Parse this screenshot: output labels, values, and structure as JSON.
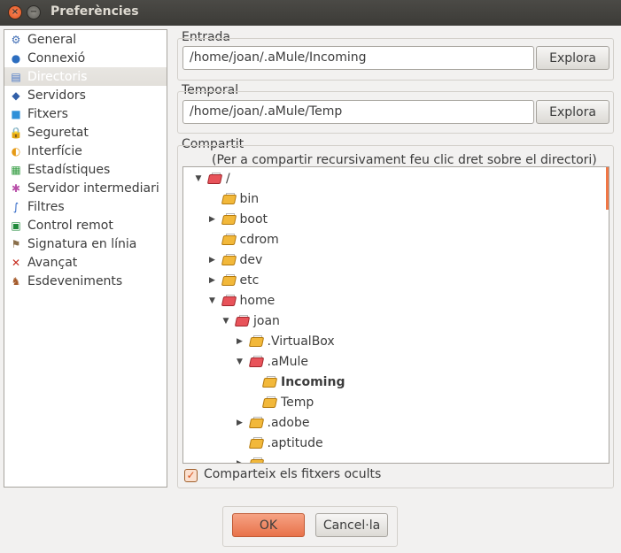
{
  "window": {
    "title": "Preferències",
    "close_glyph": "×",
    "minimize_glyph": "−"
  },
  "sidebar": {
    "items": [
      {
        "label": "General",
        "icon": "general-icon",
        "selected": false
      },
      {
        "label": "Connexió",
        "icon": "connection-icon",
        "selected": false
      },
      {
        "label": "Directoris",
        "icon": "directories-icon",
        "selected": true
      },
      {
        "label": "Servidors",
        "icon": "servers-icon",
        "selected": false
      },
      {
        "label": "Fitxers",
        "icon": "files-icon",
        "selected": false
      },
      {
        "label": "Seguretat",
        "icon": "lock-icon",
        "selected": false
      },
      {
        "label": "Interfície",
        "icon": "interface-icon",
        "selected": false
      },
      {
        "label": "Estadístiques",
        "icon": "statistics-icon",
        "selected": false
      },
      {
        "label": "Servidor intermediari",
        "icon": "proxy-icon",
        "selected": false
      },
      {
        "label": "Filtres",
        "icon": "filter-icon",
        "selected": false
      },
      {
        "label": "Control remot",
        "icon": "remote-control-icon",
        "selected": false
      },
      {
        "label": "Signatura en línia",
        "icon": "signature-icon",
        "selected": false
      },
      {
        "label": "Avançat",
        "icon": "advanced-icon",
        "selected": false
      },
      {
        "label": "Esdeveniments",
        "icon": "events-icon",
        "selected": false
      }
    ]
  },
  "incoming": {
    "label": "Entrada",
    "value": "/home/joan/.aMule/Incoming",
    "browse_label": "Explora"
  },
  "temp": {
    "label": "Temporal",
    "value": "/home/joan/.aMule/Temp",
    "browse_label": "Explora"
  },
  "shared": {
    "label": "Compartit",
    "hint": "(Per a compartir recursivament feu clic dret sobre el directori)",
    "tree": [
      {
        "label": "/",
        "depth": 0,
        "expander": "expanded",
        "color": "red",
        "bold": false
      },
      {
        "label": "bin",
        "depth": 1,
        "expander": "none",
        "color": "yellow",
        "bold": false
      },
      {
        "label": "boot",
        "depth": 1,
        "expander": "collapsed",
        "color": "yellow",
        "bold": false
      },
      {
        "label": "cdrom",
        "depth": 1,
        "expander": "none",
        "color": "yellow",
        "bold": false
      },
      {
        "label": "dev",
        "depth": 1,
        "expander": "collapsed",
        "color": "yellow",
        "bold": false
      },
      {
        "label": "etc",
        "depth": 1,
        "expander": "collapsed",
        "color": "yellow",
        "bold": false
      },
      {
        "label": "home",
        "depth": 1,
        "expander": "expanded",
        "color": "red",
        "bold": false
      },
      {
        "label": "joan",
        "depth": 2,
        "expander": "expanded",
        "color": "red",
        "bold": false
      },
      {
        "label": ".VirtualBox",
        "depth": 3,
        "expander": "collapsed",
        "color": "yellow",
        "bold": false
      },
      {
        "label": ".aMule",
        "depth": 3,
        "expander": "expanded",
        "color": "red",
        "bold": false
      },
      {
        "label": "Incoming",
        "depth": 4,
        "expander": "none",
        "color": "yellow",
        "bold": true
      },
      {
        "label": "Temp",
        "depth": 4,
        "expander": "none",
        "color": "yellow",
        "bold": false
      },
      {
        "label": ".adobe",
        "depth": 3,
        "expander": "collapsed",
        "color": "yellow",
        "bold": false
      },
      {
        "label": ".aptitude",
        "depth": 3,
        "expander": "none",
        "color": "yellow",
        "bold": false
      }
    ],
    "hidden_checkbox_label": "Comparteix els fitxers ocults",
    "hidden_checked": true,
    "check_glyph": "✓",
    "accent_color": "#f07746"
  },
  "buttons": {
    "ok_label": "OK",
    "cancel_label": "Cancel·la"
  }
}
